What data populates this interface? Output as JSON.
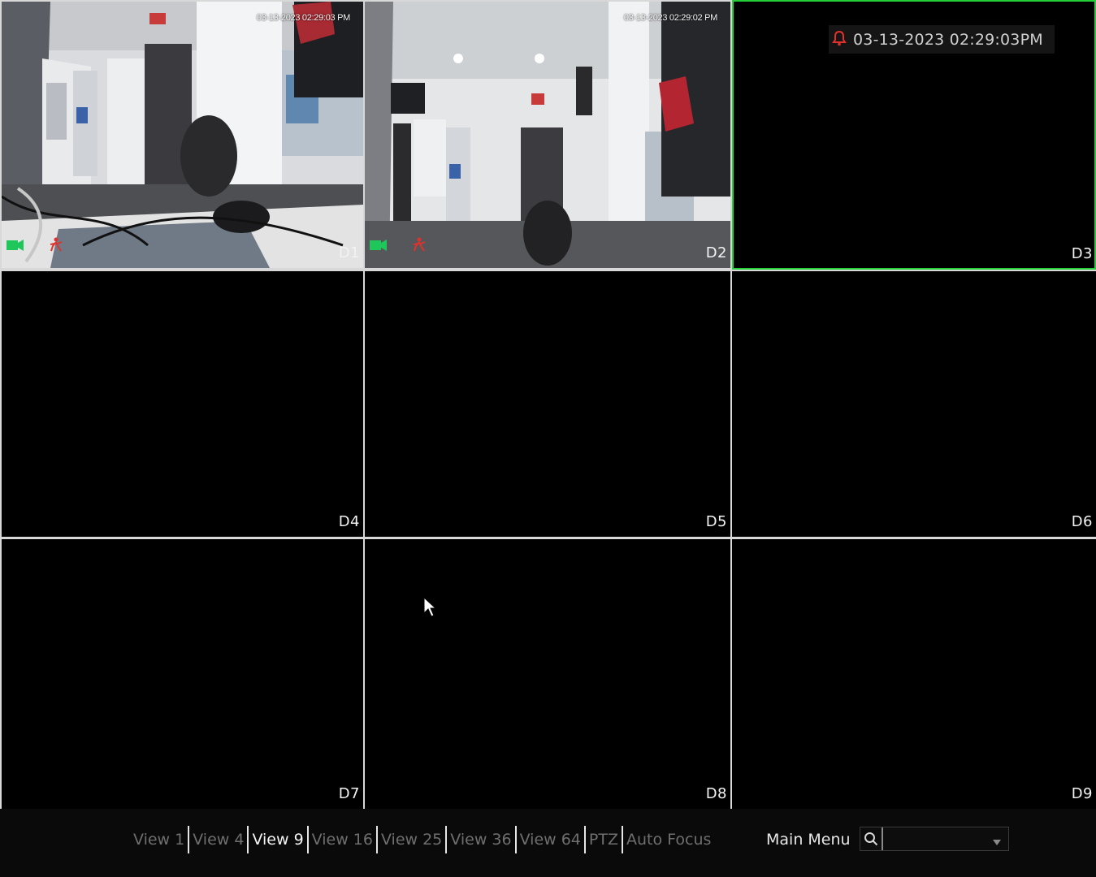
{
  "cells": [
    {
      "label": "D1",
      "timestamp": "03-13-2023 02:29:03 PM"
    },
    {
      "label": "D2",
      "timestamp": "03-13-2023 02:29:02 PM"
    },
    {
      "label": "D3",
      "alarm_timestamp": "03-13-2023 02:29:03PM"
    },
    {
      "label": "D4"
    },
    {
      "label": "D5"
    },
    {
      "label": "D6"
    },
    {
      "label": "D7"
    },
    {
      "label": "D8"
    },
    {
      "label": "D9"
    }
  ],
  "toolbar": {
    "tabs": [
      {
        "label": "View 1",
        "active": false
      },
      {
        "label": "View 4",
        "active": false
      },
      {
        "label": "View 9",
        "active": true
      },
      {
        "label": "View 16",
        "active": false
      },
      {
        "label": "View 25",
        "active": false
      },
      {
        "label": "View 36",
        "active": false
      },
      {
        "label": "View 64",
        "active": false
      },
      {
        "label": "PTZ",
        "active": false
      },
      {
        "label": "Auto Focus",
        "active": false
      }
    ],
    "main_menu_label": "Main Menu",
    "search_value": ""
  },
  "colors": {
    "selected_border": "#22d13a",
    "alarm_icon": "#e0322c",
    "record_icon": "#1fc75a",
    "motion_icon": "#e0322c"
  },
  "icons": {
    "record": "camera-record-icon",
    "motion": "motion-detect-icon",
    "alarm": "bell-icon",
    "search": "search-icon",
    "dropdown": "chevron-down-icon",
    "cursor": "mouse-pointer-icon"
  }
}
